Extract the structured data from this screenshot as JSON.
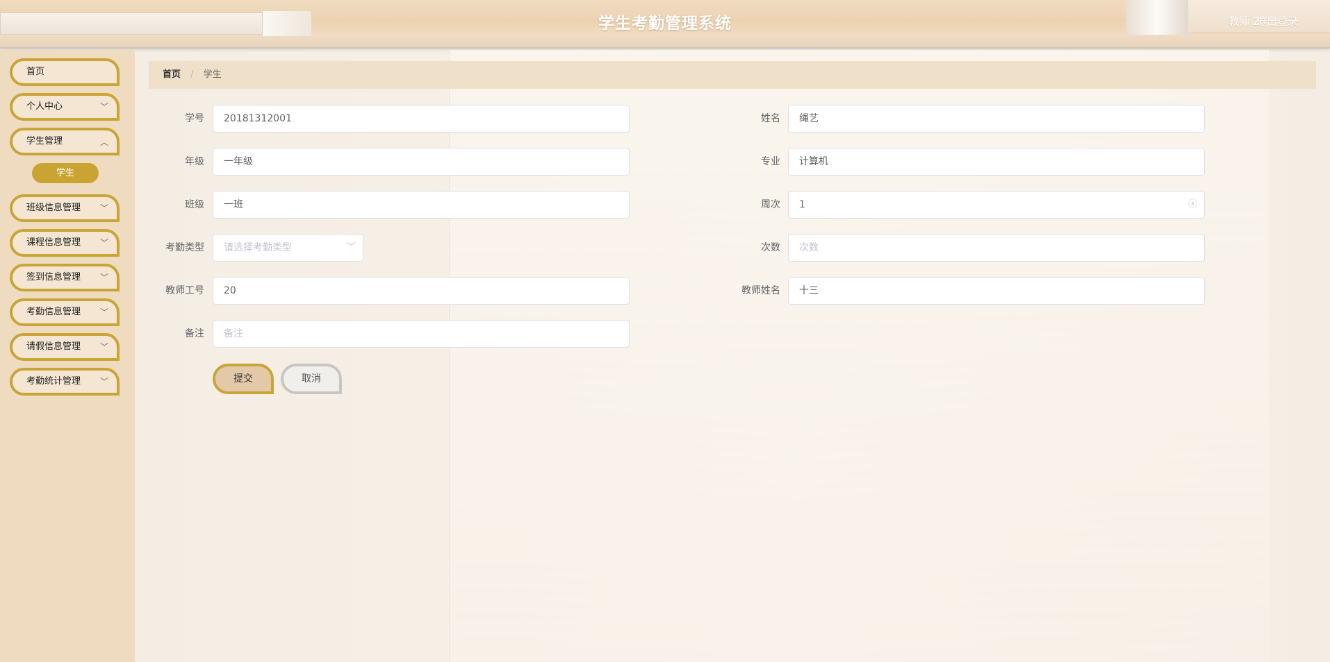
{
  "header": {
    "title": "学生考勤管理系统",
    "user": "教师 20",
    "logout": "退出登录"
  },
  "sidebar": {
    "items": [
      {
        "label": "首页",
        "has_chevron": false
      },
      {
        "label": "个人中心",
        "has_chevron": true
      },
      {
        "label": "学生管理",
        "has_chevron": true
      },
      {
        "label": "班级信息管理",
        "has_chevron": true
      },
      {
        "label": "课程信息管理",
        "has_chevron": true
      },
      {
        "label": "签到信息管理",
        "has_chevron": true
      },
      {
        "label": "考勤信息管理",
        "has_chevron": true
      },
      {
        "label": "请假信息管理",
        "has_chevron": true
      },
      {
        "label": "考勤统计管理",
        "has_chevron": true
      }
    ],
    "sub_item": "学生",
    "chevron_glyph": "﹀"
  },
  "breadcrumb": {
    "home": "首页",
    "separator": "/",
    "current": "学生"
  },
  "form": {
    "student_id": {
      "label": "学号",
      "value": "20181312001"
    },
    "name": {
      "label": "姓名",
      "value": "绳艺"
    },
    "grade": {
      "label": "年级",
      "value": "一年级"
    },
    "major": {
      "label": "专业",
      "value": "计算机"
    },
    "class": {
      "label": "班级",
      "value": "一班"
    },
    "week": {
      "label": "周次",
      "value": "1"
    },
    "attendance_type": {
      "label": "考勤类型",
      "placeholder": "请选择考勤类型"
    },
    "count": {
      "label": "次数",
      "placeholder": "次数"
    },
    "teacher_id": {
      "label": "教师工号",
      "value": "20"
    },
    "teacher_name": {
      "label": "教师姓名",
      "value": "十三"
    },
    "remark": {
      "label": "备注",
      "placeholder": "备注"
    }
  },
  "buttons": {
    "submit": "提交",
    "cancel": "取消"
  },
  "icons": {
    "clear": "ⓧ",
    "select_arrow": "﹀"
  },
  "colors": {
    "accent_gold": "#c8a537",
    "sidebar_bg": "#efdcc0",
    "breadcrumb_bg": "#efe0c9"
  }
}
